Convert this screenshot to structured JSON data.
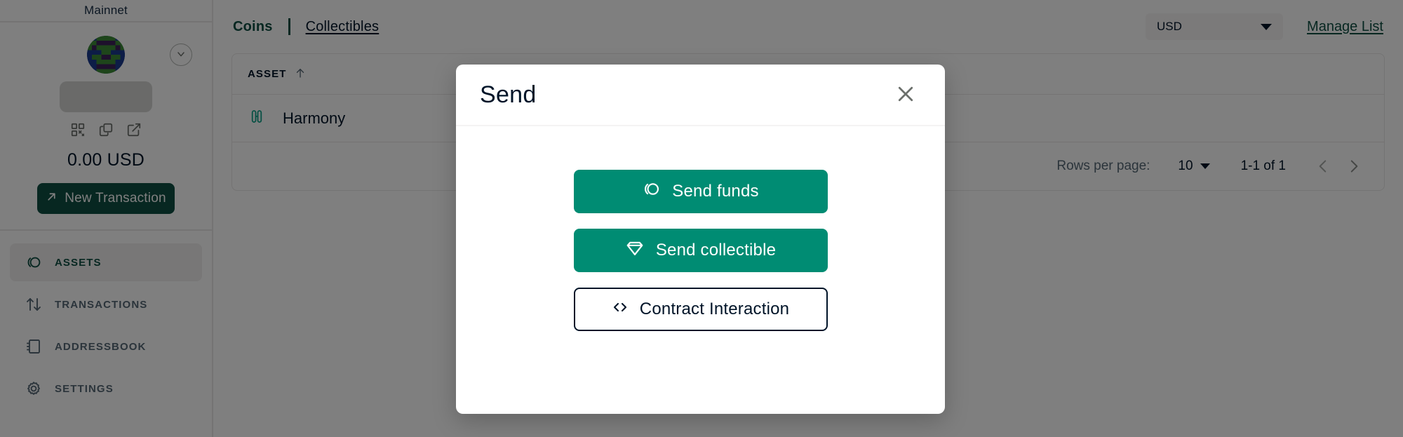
{
  "sidebar": {
    "network": "Mainnet",
    "avatar_name": "safe-identicon",
    "expand_icon": "chevron-down-icon",
    "address_placeholder_name": "address-redacted-pill",
    "address_actions": [
      {
        "name": "qr-code-icon",
        "label": "Show QR code"
      },
      {
        "name": "copy-icon",
        "label": "Copy address"
      },
      {
        "name": "external-link-icon",
        "label": "Open in block explorer"
      }
    ],
    "balance": "0.00 USD",
    "new_transaction_label": "New Transaction",
    "new_transaction_icon": "arrow-up-right-icon",
    "nav_items": [
      {
        "label": "ASSETS",
        "icon": "assets-icon",
        "active": true
      },
      {
        "label": "TRANSACTIONS",
        "icon": "transactions-icon",
        "active": false
      },
      {
        "label": "ADDRESSBOOK",
        "icon": "addressbook-icon",
        "active": false
      },
      {
        "label": "SETTINGS",
        "icon": "settings-gear-icon",
        "active": false
      }
    ]
  },
  "main": {
    "tabs": [
      {
        "label": "Coins",
        "active": true
      },
      {
        "label": "Collectibles",
        "active": false
      }
    ],
    "currency": {
      "value": "USD",
      "caret_icon": "chevron-down-icon"
    },
    "manage_list_label": "Manage List",
    "table": {
      "columns": [
        {
          "label": "ASSET",
          "sort_icon": "arrow-up-icon"
        }
      ],
      "rows": [
        {
          "icon": "harmony-token-icon",
          "asset": "Harmony"
        }
      ]
    },
    "pagination": {
      "rows_per_page_label": "Rows per page:",
      "rows_per_page_value": "10",
      "range": "1-1 of 1",
      "prev_icon": "chevron-left-icon",
      "next_icon": "chevron-right-icon"
    }
  },
  "modal": {
    "title": "Send",
    "close_icon": "close-icon",
    "actions": [
      {
        "label": "Send funds",
        "icon": "assets-icon",
        "style": "primary"
      },
      {
        "label": "Send collectible",
        "icon": "diamond-icon",
        "style": "primary"
      },
      {
        "label": "Contract Interaction",
        "icon": "code-brackets-icon",
        "style": "outline"
      }
    ]
  },
  "colors": {
    "brand_dark": "#0e4f43",
    "brand_green": "#008c73",
    "text": "#001428",
    "muted": "#566976",
    "border": "#e8e7e6"
  }
}
